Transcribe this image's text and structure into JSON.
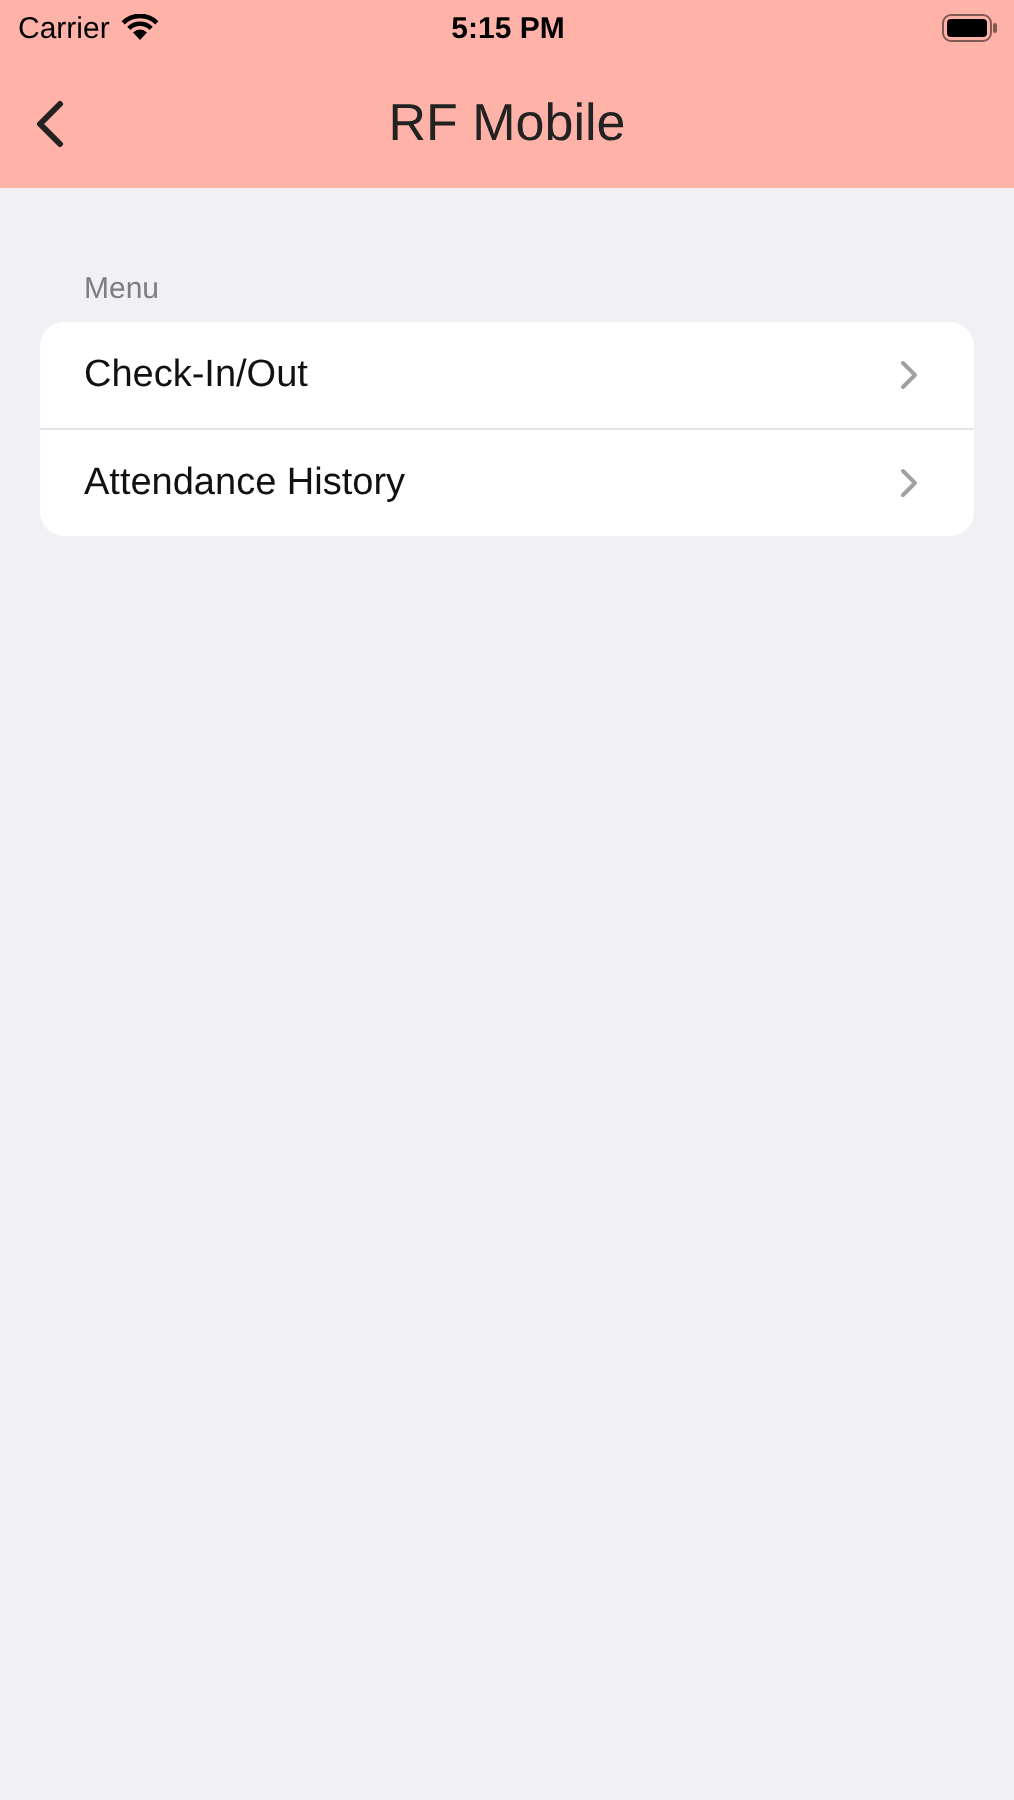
{
  "status_bar": {
    "carrier": "Carrier",
    "time": "5:15 PM"
  },
  "nav_bar": {
    "title": "RF Mobile"
  },
  "menu": {
    "header": "Menu",
    "items": [
      {
        "label": "Check-In/Out"
      },
      {
        "label": "Attendance History"
      }
    ]
  }
}
